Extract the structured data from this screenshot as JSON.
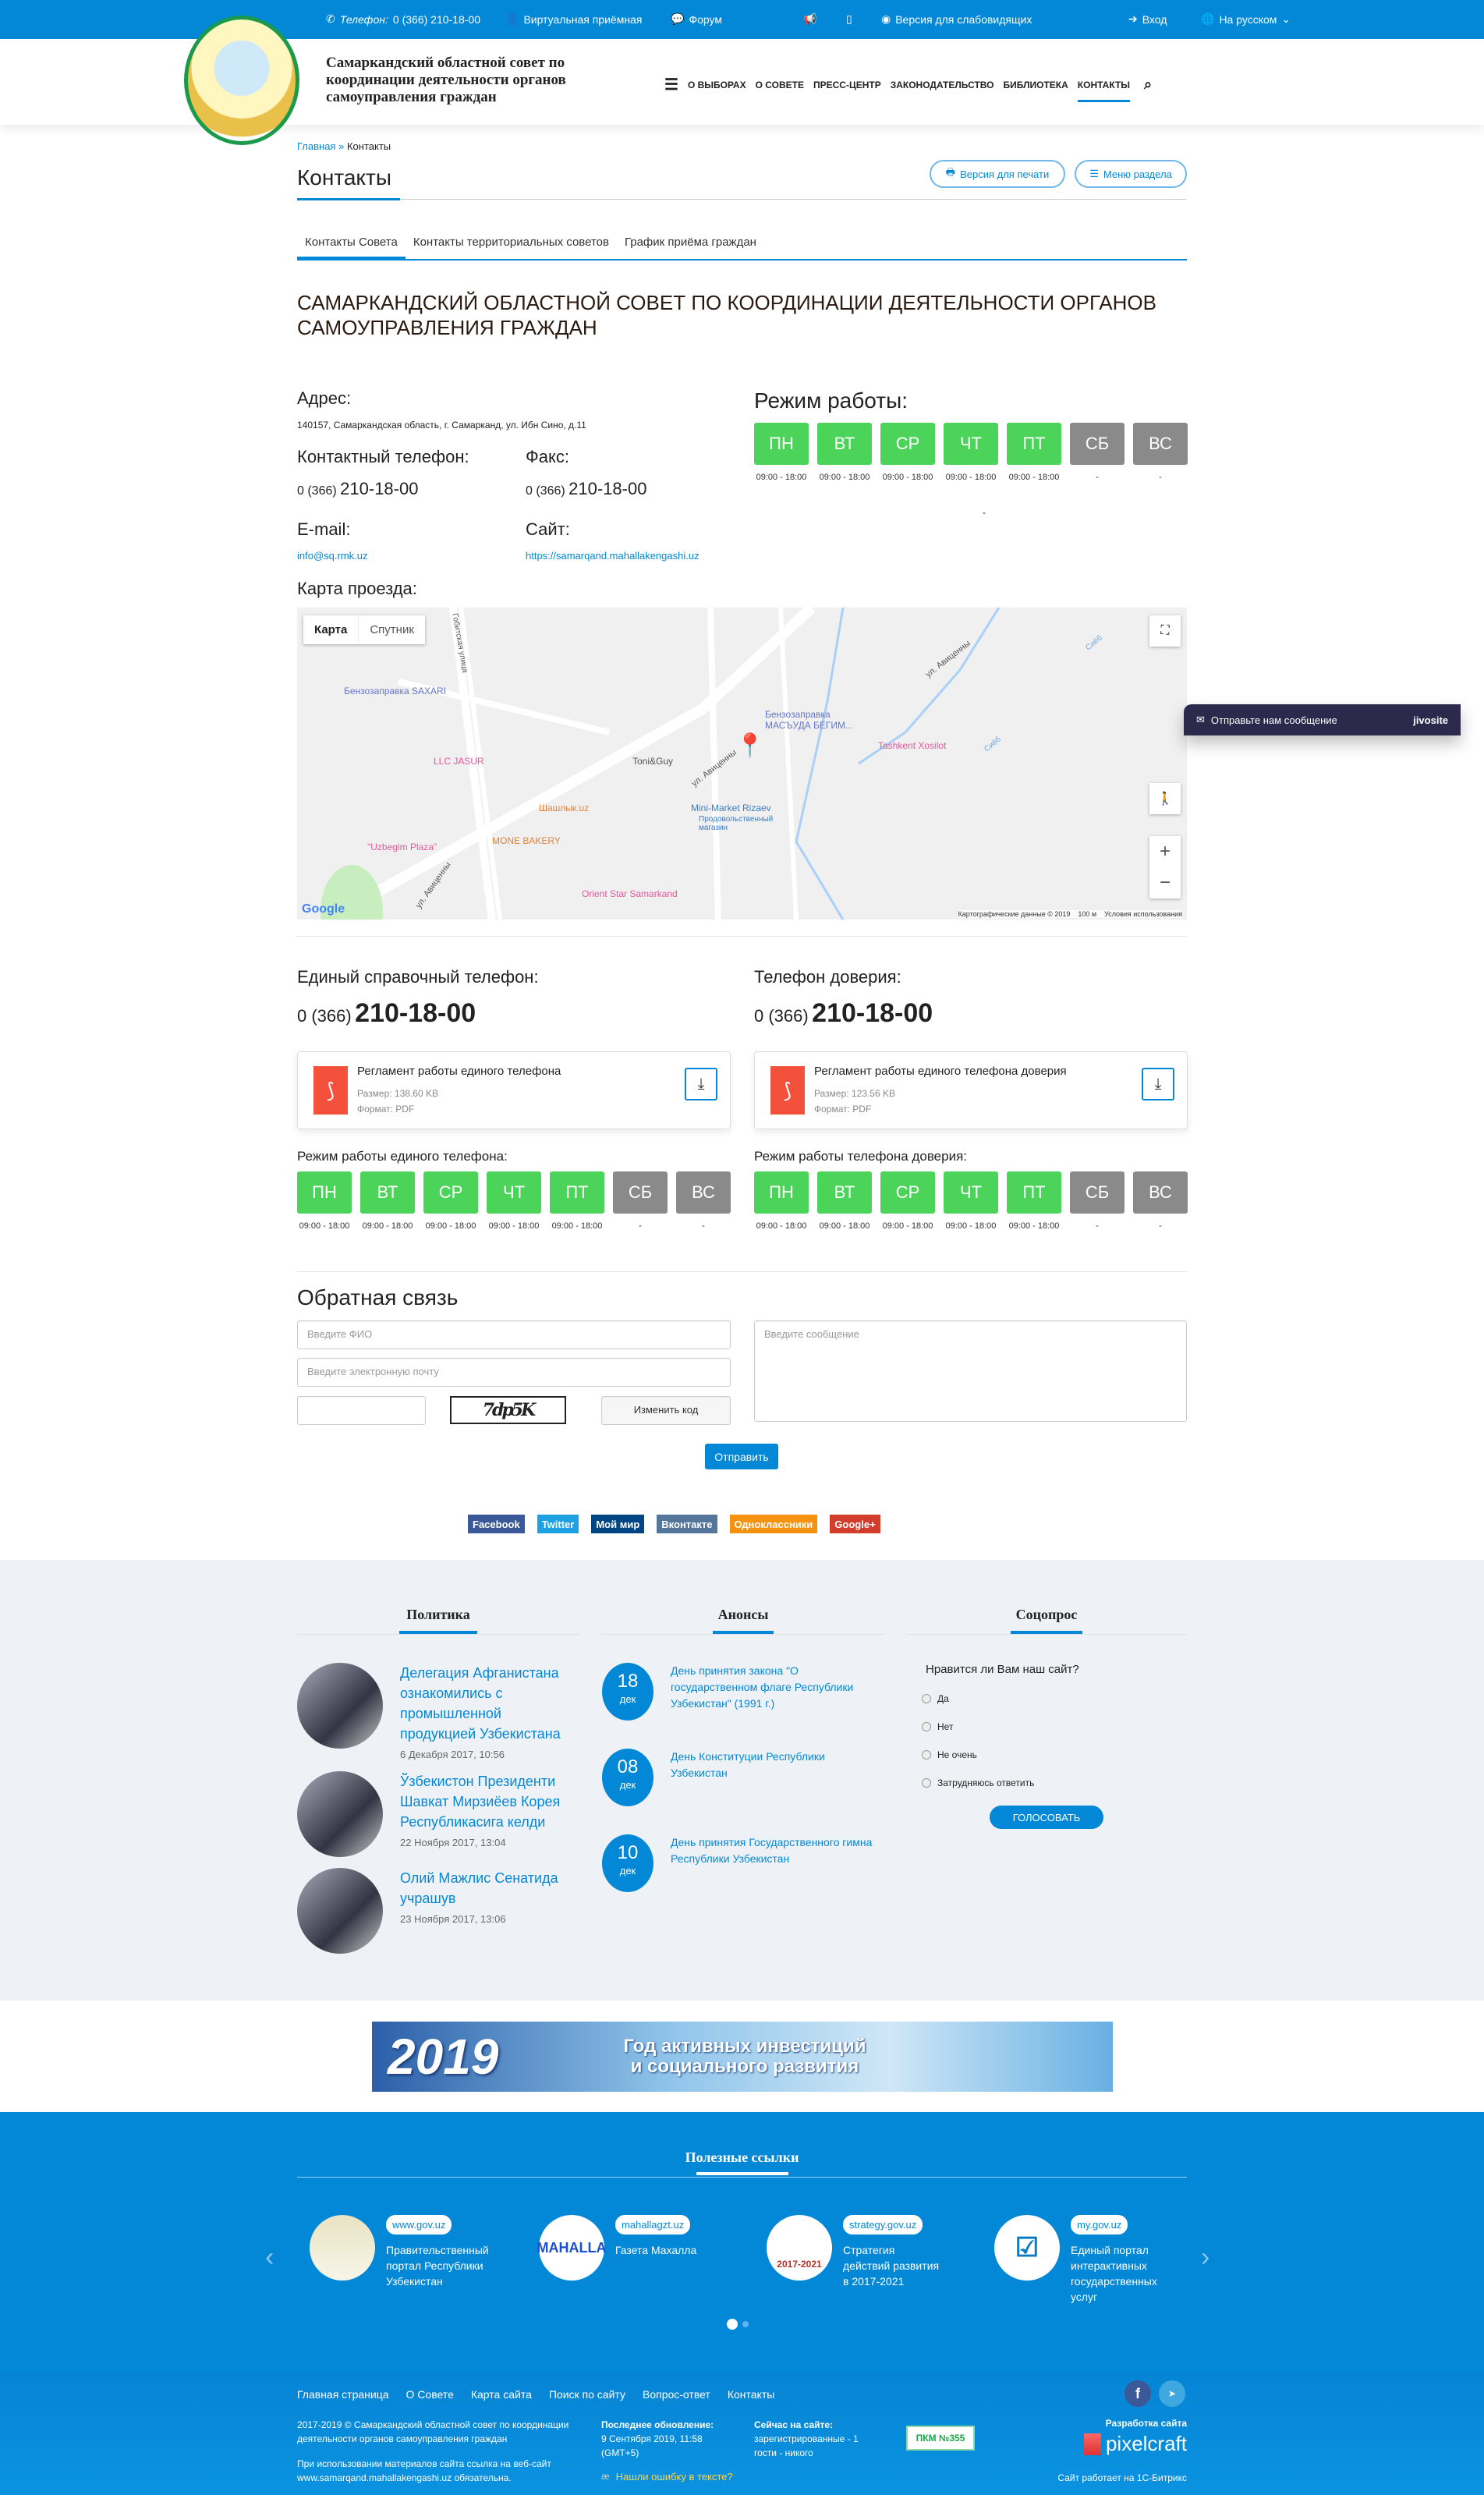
{
  "topbar": {
    "phone_label": "Телефон:",
    "phone": "0 (366) 210-18-00",
    "virtual_reception": "Виртуальная приёмная",
    "forum": "Форум",
    "low_vision": "Версия для слабовидящих",
    "login": "Вход",
    "language": "На русском"
  },
  "header": {
    "site_name": "Самаркандский областной совет по координации деятельности органов самоуправления граждан",
    "nav": [
      "О ВЫБОРАХ",
      "О СОВЕТЕ",
      "ПРЕСС-ЦЕНТР",
      "ЗАКОНОДАТЕЛЬСТВО",
      "БИБЛИОТЕКА",
      "КОНТАКТЫ"
    ],
    "active_nav": "КОНТАКТЫ"
  },
  "breadcrumb": {
    "home": "Главная",
    "sep": "»",
    "current": "Контакты"
  },
  "page": {
    "title": "Контакты",
    "print_button": "Версия для печати",
    "section_menu_button": "Меню раздела",
    "tabs": [
      "Контакты Совета",
      "Контакты территориальных советов",
      "График приёма граждан"
    ],
    "active_tab": "Контакты Совета"
  },
  "org": {
    "title": "САМАРКАНДСКИЙ ОБЛАСТНОЙ СОВЕТ ПО КООРДИНАЦИИ ДЕЯТЕЛЬНОСТИ ОРГАНОВ САМОУПРАВЛЕНИЯ ГРАЖДАН",
    "address_label": "Адрес:",
    "address": "140157, Самаркандская область, г. Самарканд, ул. Ибн Сино, д.11",
    "phone_label": "Контактный телефон:",
    "phone_code": "0 (366)",
    "phone_number": "210-18-00",
    "fax_label": "Факс:",
    "fax_code": "0 (366)",
    "fax_number": "210-18-00",
    "email_label": "E-mail:",
    "email": "info@sq.rmk.uz",
    "site_label": "Сайт:",
    "site": "https://samarqand.mahallakengashi.uz",
    "schedule_label": "Режим работы:",
    "schedule_note": "-"
  },
  "schedule": {
    "days": [
      "ПН",
      "ВТ",
      "СР",
      "ЧТ",
      "ПТ",
      "СБ",
      "ВС"
    ],
    "times": [
      "09:00 - 18:00",
      "09:00 - 18:00",
      "09:00 - 18:00",
      "09:00 - 18:00",
      "09:00 - 18:00",
      "-",
      "-"
    ],
    "working": [
      true,
      true,
      true,
      true,
      true,
      false,
      false
    ],
    "colors": {
      "working": "#4cd45a",
      "off": "#8a8a8a"
    }
  },
  "map": {
    "label": "Карта проезда:",
    "type_map": "Карта",
    "type_satellite": "Спутник",
    "places": [
      "Бензозаправка SAXARI",
      "Бензозаправка МАСЪУДА БЕГИМ...",
      "LLC JASUR",
      "Toni&Guy",
      "Tashkent Xosilot",
      "Шашлык.uz",
      "Mini-Market Rizaev",
      "Продовольственный магазин",
      "MONE BAKERY",
      "\"Uzbegim Plaza\"",
      "Orient Star Samarkand"
    ],
    "streets": [
      "ул. Авиценны",
      "ул. Авиценны",
      "ул. Авиценны",
      "Сиёб",
      "Сиёб",
      "Гобитская улица"
    ],
    "logo": "Google",
    "attribution": "Картографические данные © 2019",
    "scale": "100 м",
    "terms": "Условия использования"
  },
  "hotline": {
    "unified_label": "Единый справочный телефон:",
    "unified_code": "0 (366)",
    "unified_number": "210-18-00",
    "trust_label": "Телефон доверия:",
    "trust_code": "0 (366)",
    "trust_number": "210-18-00",
    "docs": [
      {
        "title": "Регламент работы единого телефона",
        "size": "Размер: 138.60 KB",
        "format": "Формат: PDF"
      },
      {
        "title": "Регламент работы единого телефона доверия",
        "size": "Размер: 123.56 KB",
        "format": "Формат: PDF"
      }
    ],
    "unified_schedule_label": "Режим работы единого телефона:",
    "trust_schedule_label": "Режим работы телефона доверия:"
  },
  "feedback": {
    "title": "Обратная связь",
    "name_placeholder": "Введите ФИО",
    "email_placeholder": "Введите электронную почту",
    "message_placeholder": "Введите сообщение",
    "captcha_text": "7dp5K",
    "change_code": "Изменить код",
    "submit": "Отправить"
  },
  "share": [
    {
      "label": "Facebook",
      "color": "#3b5998"
    },
    {
      "label": "Twitter",
      "color": "#1da1e2"
    },
    {
      "label": "Мой мир",
      "color": "#004584"
    },
    {
      "label": "Вконтакте",
      "color": "#54769a"
    },
    {
      "label": "Одноклассники",
      "color": "#f59310"
    },
    {
      "label": "Google+",
      "color": "#d23e2b"
    }
  ],
  "jivosite": {
    "text": "Отправьте нам сообщение",
    "brand": "jivosite"
  },
  "politics": {
    "title": "Политика",
    "items": [
      {
        "title": "Делегация Афганистана ознакомились с промышленной продукцией Узбекистана",
        "date": "6 Декабря 2017, 10:56"
      },
      {
        "title": "Ўзбекистон Президенти Шавкат Мирзиёев Корея Республикасига келди",
        "date": "22 Ноября 2017, 13:04"
      },
      {
        "title": "Олий Мажлис Сенатида учрашув",
        "date": "23 Ноября 2017, 13:06"
      }
    ]
  },
  "announcements": {
    "title": "Анонсы",
    "items": [
      {
        "day": "18",
        "month": "дек",
        "title": "День принятия закона \"О государственном флаге Республики Узбекистан\" (1991 г.)"
      },
      {
        "day": "08",
        "month": "дек",
        "title": "День Конституции Республики Узбекистан"
      },
      {
        "day": "10",
        "month": "дек",
        "title": "День принятия Государственного гимна Республики Узбекистан"
      }
    ]
  },
  "poll": {
    "title": "Соцопрос",
    "question": "Нравится ли Вам наш сайт?",
    "options": [
      "Да",
      "Нет",
      "Не очень",
      "Затрудняюсь ответить"
    ],
    "vote": "ГОЛОСОВАТЬ"
  },
  "banner": {
    "year": "2019",
    "text_line1": "Год активных инвестиций",
    "text_line2": "и социального развития"
  },
  "useful_links": {
    "title": "Полезные ссылки",
    "items": [
      {
        "tag": "www.gov.uz",
        "text": "Правительственный портал Республики Узбекистан"
      },
      {
        "tag": "mahallagzt.uz",
        "text": "Газета Махалла",
        "logo": "MAHALLA"
      },
      {
        "tag": "strategy.gov.uz",
        "text": "Стратегия действий развития в 2017-2021",
        "logo": "2017-2021"
      },
      {
        "tag": "my.gov.uz",
        "text": "Единый портал интерактивных государственных услуг"
      }
    ],
    "page": 1,
    "pages": 2
  },
  "footer": {
    "links": [
      "Главная страница",
      "О Совете",
      "Карта сайта",
      "Поиск по сайту",
      "Вопрос-ответ",
      "Контакты"
    ],
    "copyright": "2017-2019 © Самаркандский областной совет по координации деятельности органов самоуправления граждан",
    "notice": "При использовании материалов сайта ссылка на веб-сайт www.samarqand.mahallakengashi.uz обязательна.",
    "updated_label": "Последнее обновление:",
    "updated_value": "9 Сентября 2019, 11:58 (GMT+5)",
    "online_label": "Сейчас на сайте:",
    "online_registered": "зарегистрированные - 1",
    "online_guests": "гости - никого",
    "badge": "ПКМ №355",
    "typo": "Нашли ошибку в тексте?",
    "dev_label": "Разработка сайта",
    "dev_brand": "pixelcraft",
    "bitrix": "Сайт работает на 1С-Битрикс"
  }
}
